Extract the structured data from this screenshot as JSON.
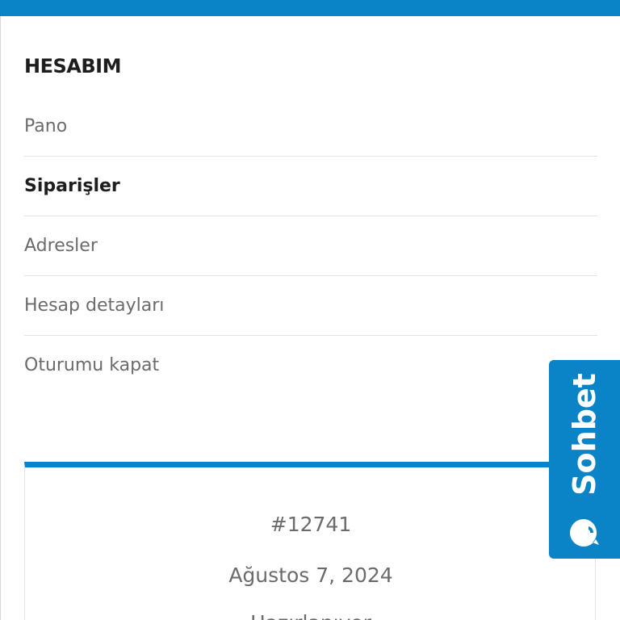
{
  "account": {
    "title": "HESABIM",
    "menu": [
      {
        "label": "Pano"
      },
      {
        "label": "Siparişler"
      },
      {
        "label": "Adresler"
      },
      {
        "label": "Hesap detayları"
      },
      {
        "label": "Oturumu kapat"
      }
    ]
  },
  "order": {
    "number": "#12741",
    "date": "Ağustos 7, 2024",
    "status": "Hazırlanıyor"
  },
  "chat": {
    "label": "Sohbet",
    "icon": "chat-bubble-icon"
  },
  "colors": {
    "accent": "#0a84c6",
    "text_dark": "#1e1e1e",
    "text_muted": "#6b6b6b",
    "divider": "#e3e3e3"
  }
}
